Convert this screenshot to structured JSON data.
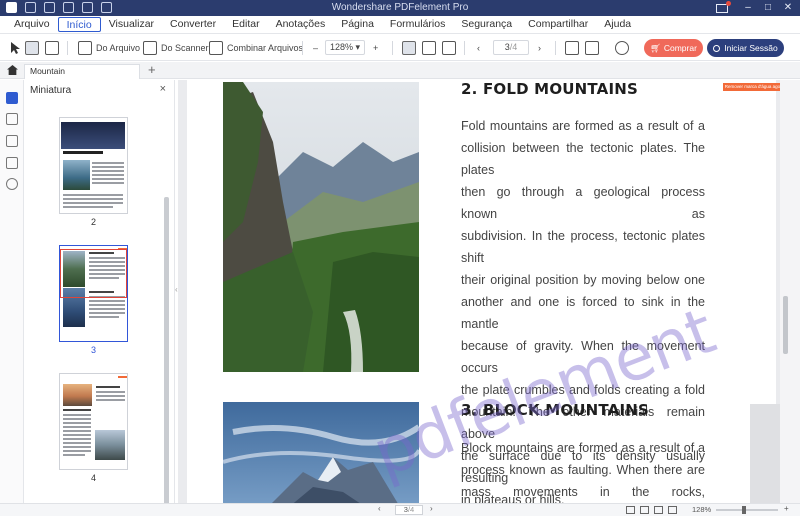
{
  "window": {
    "title": "Wondershare PDFelement Pro"
  },
  "menu": [
    "Arquivo",
    "Início",
    "Visualizar",
    "Converter",
    "Editar",
    "Anotações",
    "Página",
    "Formulários",
    "Segurança",
    "Compartilhar",
    "Ajuda"
  ],
  "toolbar": {
    "from_file": "Do Arquivo",
    "from_scanner": "Do Scanner",
    "combine": "Combinar Arquivos",
    "zoom_minus": "–",
    "zoom": "128%",
    "zoom_plus": "+",
    "page_current": "3",
    "page_total": "/4",
    "buy": "Comprar",
    "login": "Iniciar Sessão"
  },
  "tabs": {
    "doc_tab": "Mountain",
    "add": "+"
  },
  "panel": {
    "title": "Miniatura",
    "close": "×",
    "thumbnails": [
      {
        "label": "2"
      },
      {
        "label": "3",
        "selected": true
      },
      {
        "label": "4"
      }
    ]
  },
  "document": {
    "remove_badge": "Remover marca d'água agora",
    "section1_title": "2. FOLD MOUNTAINS",
    "section1_lines": [
      "Fold mountains are formed as a result of a",
      "collision between the tectonic plates. The plates",
      "then go through a geological process known as",
      "subdivision. In the process, tectonic plates shift",
      "their original position by moving below one",
      "another and one is forced to sink in the mantle",
      "because of gravity. When the movement occurs",
      "the plate crumbles and folds creating a fold",
      "mountain. The other materials remain above",
      "the surface due to its density usually resulting",
      "in plateaus or hills."
    ],
    "section2_title": "3. BLOCK MOUNTAINS",
    "section2_lines": [
      "Block mountains are formed as a result of a",
      "process known as faulting. When there are",
      "mass movements in the rocks, displacement"
    ],
    "watermark": "pdfelement"
  },
  "status": {
    "page": "3",
    "page_total": "/4",
    "zoom": "128%"
  },
  "colors": {
    "accent": "#2f5bd0",
    "buy": "#f0695a",
    "login": "#2c3f7d",
    "titlebar": "#2b3c6e"
  }
}
